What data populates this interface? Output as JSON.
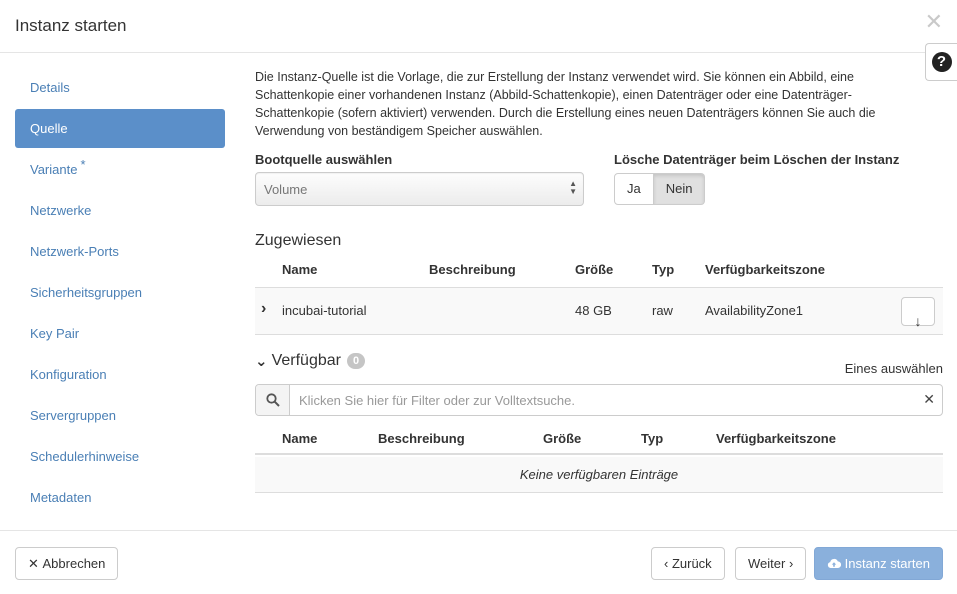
{
  "modal": {
    "title": "Instanz starten",
    "close_icon": "close-icon",
    "help_icon": "question-circle-icon"
  },
  "sidebar": {
    "items": [
      {
        "label": "Details",
        "active": false,
        "required": false
      },
      {
        "label": "Quelle",
        "active": true,
        "required": false
      },
      {
        "label": "Variante",
        "active": false,
        "required": true
      },
      {
        "label": "Netzwerke",
        "active": false,
        "required": false
      },
      {
        "label": "Netzwerk-Ports",
        "active": false,
        "required": false
      },
      {
        "label": "Sicherheitsgruppen",
        "active": false,
        "required": false
      },
      {
        "label": "Key Pair",
        "active": false,
        "required": false
      },
      {
        "label": "Konfiguration",
        "active": false,
        "required": false
      },
      {
        "label": "Servergruppen",
        "active": false,
        "required": false
      },
      {
        "label": "Schedulerhinweise",
        "active": false,
        "required": false
      },
      {
        "label": "Metadaten",
        "active": false,
        "required": false
      }
    ],
    "required_marker": "*"
  },
  "main": {
    "intro": "Die Instanz-Quelle ist die Vorlage, die zur Erstellung der Instanz verwendet wird. Sie können ein Abbild, eine Schattenkopie einer vorhandenen Instanz (Abbild-Schattenkopie), einen Datenträger oder eine Datenträger-Schattenkopie (sofern aktiviert) verwenden. Durch die Erstellung eines neuen Datenträgers können Sie auch die Verwendung von beständigem Speicher auswählen.",
    "boot_source": {
      "label": "Bootquelle auswählen",
      "value": "Volume"
    },
    "delete_volume": {
      "label": "Lösche Datenträger beim Löschen der Instanz",
      "options": [
        "Ja",
        "Nein"
      ],
      "selected": "Nein"
    },
    "allocated": {
      "title": "Zugewiesen",
      "columns": [
        "Name",
        "Beschreibung",
        "Größe",
        "Typ",
        "Verfügbarkeitszone"
      ],
      "rows": [
        {
          "name": "incubai-tutorial",
          "description": "",
          "size": "48 GB",
          "type": "raw",
          "zone": "AvailabilityZone1"
        }
      ]
    },
    "available": {
      "title": "Verfügbar",
      "count": "0",
      "pick_hint": "Eines auswählen",
      "filter_placeholder": "Klicken Sie hier für Filter oder zur Volltextsuche.",
      "columns": [
        "Name",
        "Beschreibung",
        "Größe",
        "Typ",
        "Verfügbarkeitszone"
      ],
      "empty_text": "Keine verfügbaren Einträge"
    }
  },
  "footer": {
    "cancel_label": "Abbrechen",
    "back_label": "Zurück",
    "next_label": "Weiter",
    "launch_label": "Instanz starten",
    "colors": {
      "launch_bg": "#8ab0dc",
      "active_nav": "#5b8fc9",
      "link": "#4a7fb5"
    }
  }
}
